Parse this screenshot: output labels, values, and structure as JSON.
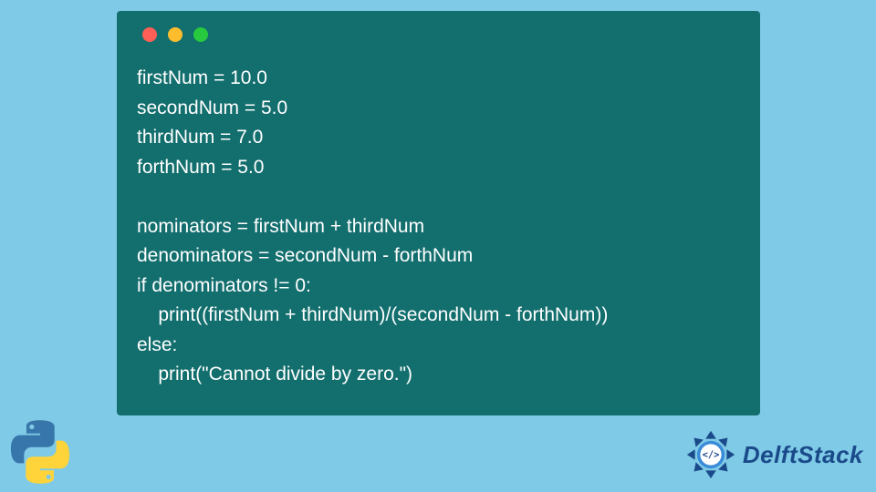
{
  "code": {
    "lines": [
      "firstNum = 10.0",
      "secondNum = 5.0",
      "thirdNum = 7.0",
      "forthNum = 5.0",
      "",
      "nominators = firstNum + thirdNum",
      "denominators = secondNum - forthNum",
      "if denominators != 0:",
      "    print((firstNum + thirdNum)/(secondNum - forthNum))",
      "else:",
      "    print(\"Cannot divide by zero.\")"
    ]
  },
  "brand": {
    "name": "DelftStack"
  },
  "colors": {
    "page_bg": "#7fcae6",
    "window_bg": "#136e6e",
    "code_text": "#ffffff",
    "brand_text": "#1a4a8a",
    "dot_red": "#ff5f56",
    "dot_yellow": "#ffbd2e",
    "dot_green": "#27c93f"
  }
}
